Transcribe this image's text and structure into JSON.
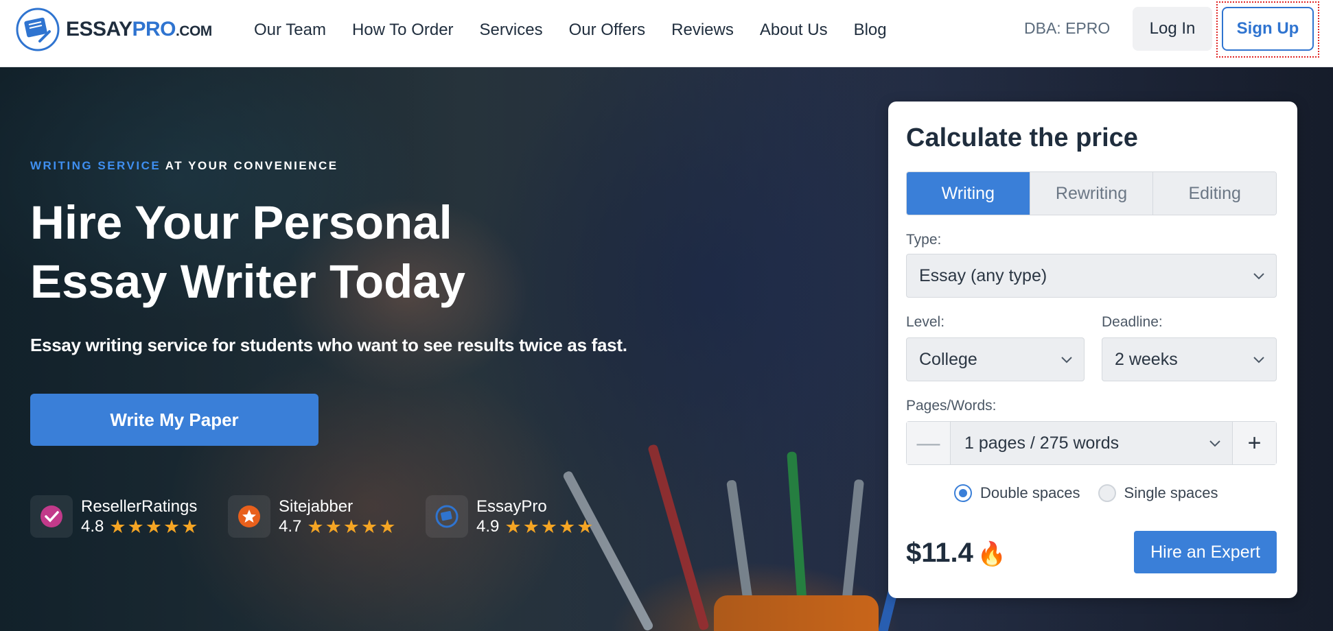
{
  "header": {
    "logo": {
      "brand_main": "ESSAY",
      "brand_accent": "PRO",
      "brand_suffix": ".COM"
    },
    "nav": [
      "Our Team",
      "How To Order",
      "Services",
      "Our Offers",
      "Reviews",
      "About Us",
      "Blog"
    ],
    "dba": "DBA: EPRO",
    "login_label": "Log In",
    "signup_label": "Sign Up"
  },
  "hero": {
    "eyebrow_accent": "WRITING SERVICE",
    "eyebrow_rest": " AT YOUR CONVENIENCE",
    "headline_line1": "Hire Your Personal",
    "headline_line2": "Essay Writer Today",
    "subline": "Essay writing service for students who want to see results twice as fast.",
    "cta_label": "Write My Paper",
    "ratings": [
      {
        "name": "ResellerRatings",
        "score": "4.8",
        "icon": "check-badge-icon",
        "stars": 5
      },
      {
        "name": "Sitejabber",
        "score": "4.7",
        "icon": "star-chat-icon",
        "stars": 5
      },
      {
        "name": "EssayPro",
        "score": "4.9",
        "icon": "essaypro-logo-icon",
        "stars": 5
      }
    ]
  },
  "calculator": {
    "title": "Calculate the price",
    "tabs": [
      {
        "label": "Writing",
        "active": true
      },
      {
        "label": "Rewriting",
        "active": false
      },
      {
        "label": "Editing",
        "active": false
      }
    ],
    "type_label": "Type:",
    "type_value": "Essay (any type)",
    "level_label": "Level:",
    "level_value": "College",
    "deadline_label": "Deadline:",
    "deadline_value": "2 weeks",
    "pages_label": "Pages/Words:",
    "pages_value": "1 pages / 275 words",
    "spacing_options": [
      {
        "label": "Double spaces",
        "selected": true
      },
      {
        "label": "Single spaces",
        "selected": false
      }
    ],
    "price": "$11.4",
    "hire_label": "Hire an Expert"
  },
  "colors": {
    "accent": "#3a7fd8",
    "star": "#f5a524",
    "focus_outline": "#e02424"
  }
}
